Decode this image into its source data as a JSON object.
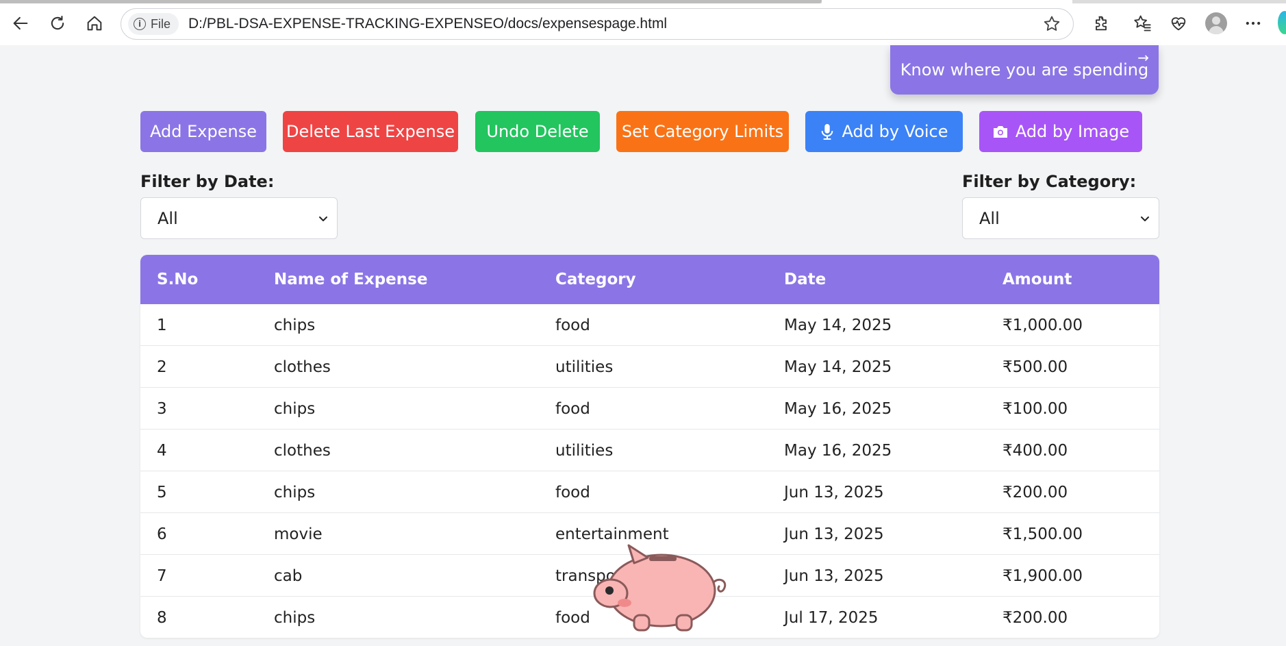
{
  "browser": {
    "site_chip_label": "File",
    "url": "D:/PBL-DSA-EXPENSE-TRACKING-EXPENSEO/docs/expensespage.html",
    "icons": [
      "back-icon",
      "refresh-icon",
      "home-icon",
      "info-icon",
      "star-icon",
      "extensions-icon",
      "favorites-icon",
      "performance-icon",
      "profile-avatar",
      "more-icon"
    ]
  },
  "banner": {
    "text": "Know where you are spending",
    "arrow": "→"
  },
  "actions": {
    "add_expense": "Add Expense",
    "delete_last": "Delete Last Expense",
    "undo_delete": "Undo Delete",
    "set_limits": "Set Category Limits",
    "add_voice": "Add by Voice",
    "add_image": "Add by Image"
  },
  "colors": {
    "accent": "#8b75e6",
    "delete": "#ef4444",
    "undo": "#22c55e",
    "limits": "#f97316",
    "voice": "#3b82f6",
    "image": "#a855f7"
  },
  "filters": {
    "date_label": "Filter by Date:",
    "date_value": "All",
    "category_label": "Filter by Category:",
    "category_value": "All"
  },
  "table": {
    "headers": [
      "S.No",
      "Name of Expense",
      "Category",
      "Date",
      "Amount"
    ],
    "rows": [
      [
        "1",
        "chips",
        "food",
        "May 14, 2025",
        "₹1,000.00"
      ],
      [
        "2",
        "clothes",
        "utilities",
        "May 14, 2025",
        "₹500.00"
      ],
      [
        "3",
        "chips",
        "food",
        "May 16, 2025",
        "₹100.00"
      ],
      [
        "4",
        "clothes",
        "utilities",
        "May 16, 2025",
        "₹400.00"
      ],
      [
        "5",
        "chips",
        "food",
        "Jun 13, 2025",
        "₹200.00"
      ],
      [
        "6",
        "movie",
        "entertainment",
        "Jun 13, 2025",
        "₹1,500.00"
      ],
      [
        "7",
        "cab",
        "transport",
        "Jun 13, 2025",
        "₹1,900.00"
      ],
      [
        "8",
        "chips",
        "food",
        "Jul 17, 2025",
        "₹200.00"
      ]
    ]
  }
}
